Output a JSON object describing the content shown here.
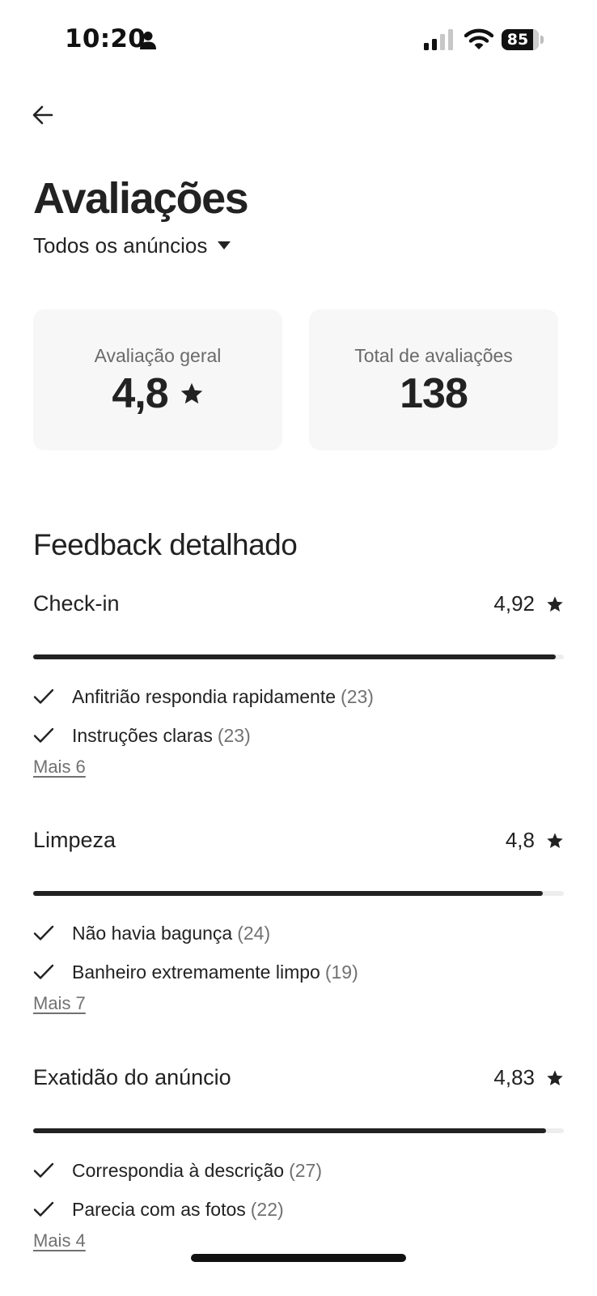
{
  "status_bar": {
    "time": "10:20",
    "battery": "85",
    "battery_level": 0.85,
    "icons": [
      "person-icon",
      "signal-icon",
      "wifi-icon",
      "battery-icon"
    ]
  },
  "header": {
    "back_icon": "arrow-left-icon",
    "title": "Avaliações",
    "filter": "Todos os anúncios",
    "filter_icon": "caret-down-icon"
  },
  "summary": {
    "overall_label": "Avaliação geral",
    "overall_value": "4,8",
    "total_label": "Total de avaliações",
    "total_value": "138",
    "star_icon": "star-icon"
  },
  "feedback": {
    "title": "Feedback detalhado",
    "categories": [
      {
        "name": "Check-in",
        "score": "4,92",
        "progress": 0.984,
        "tags": [
          {
            "text": "Anfitrião respondia rapidamente",
            "count": "(23)"
          },
          {
            "text": "Instruções claras",
            "count": "(23)"
          }
        ],
        "more": "Mais 6"
      },
      {
        "name": "Limpeza",
        "score": "4,8",
        "progress": 0.96,
        "tags": [
          {
            "text": "Não havia bagunça",
            "count": "(24)"
          },
          {
            "text": "Banheiro extremamente limpo",
            "count": "(19)"
          }
        ],
        "more": "Mais 7"
      },
      {
        "name": "Exatidão do anúncio",
        "score": "4,83",
        "progress": 0.966,
        "tags": [
          {
            "text": "Correspondia à descrição",
            "count": "(27)"
          },
          {
            "text": "Parecia com as fotos",
            "count": "(22)"
          }
        ],
        "more": "Mais 4"
      }
    ]
  },
  "colors": {
    "text": "#222222",
    "muted": "#717171",
    "card_bg": "#f7f7f7",
    "bar_track": "#ededed"
  }
}
